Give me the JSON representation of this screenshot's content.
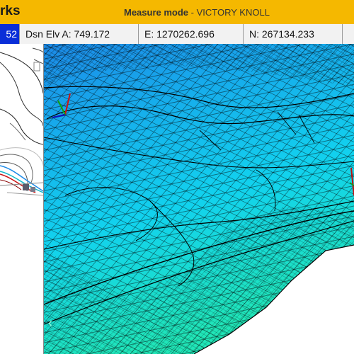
{
  "titlebar": {
    "app_name": "rks",
    "mode_label": "Measure mode",
    "separator": " - ",
    "project_name": "VICTORY KNOLL",
    "background": "#F5B800"
  },
  "statusbar": {
    "point_value": "52",
    "design_elevation": "Dsn Elv A: 749.172",
    "easting": "E: 1270262.696",
    "northing": "N: 267134.233",
    "active_color": "#0A2ED8"
  },
  "viewport": {
    "surface_colors": [
      "#1C8AE8",
      "#12D2EE",
      "#20E6B8"
    ],
    "nav_arrow_icon": "chevron-left-icon",
    "axis_gizmo_icon": "axis-gizmo-icon",
    "nav_arrow": "‹"
  },
  "plan_view": {
    "cursor_icon": "position-marker-icon"
  }
}
